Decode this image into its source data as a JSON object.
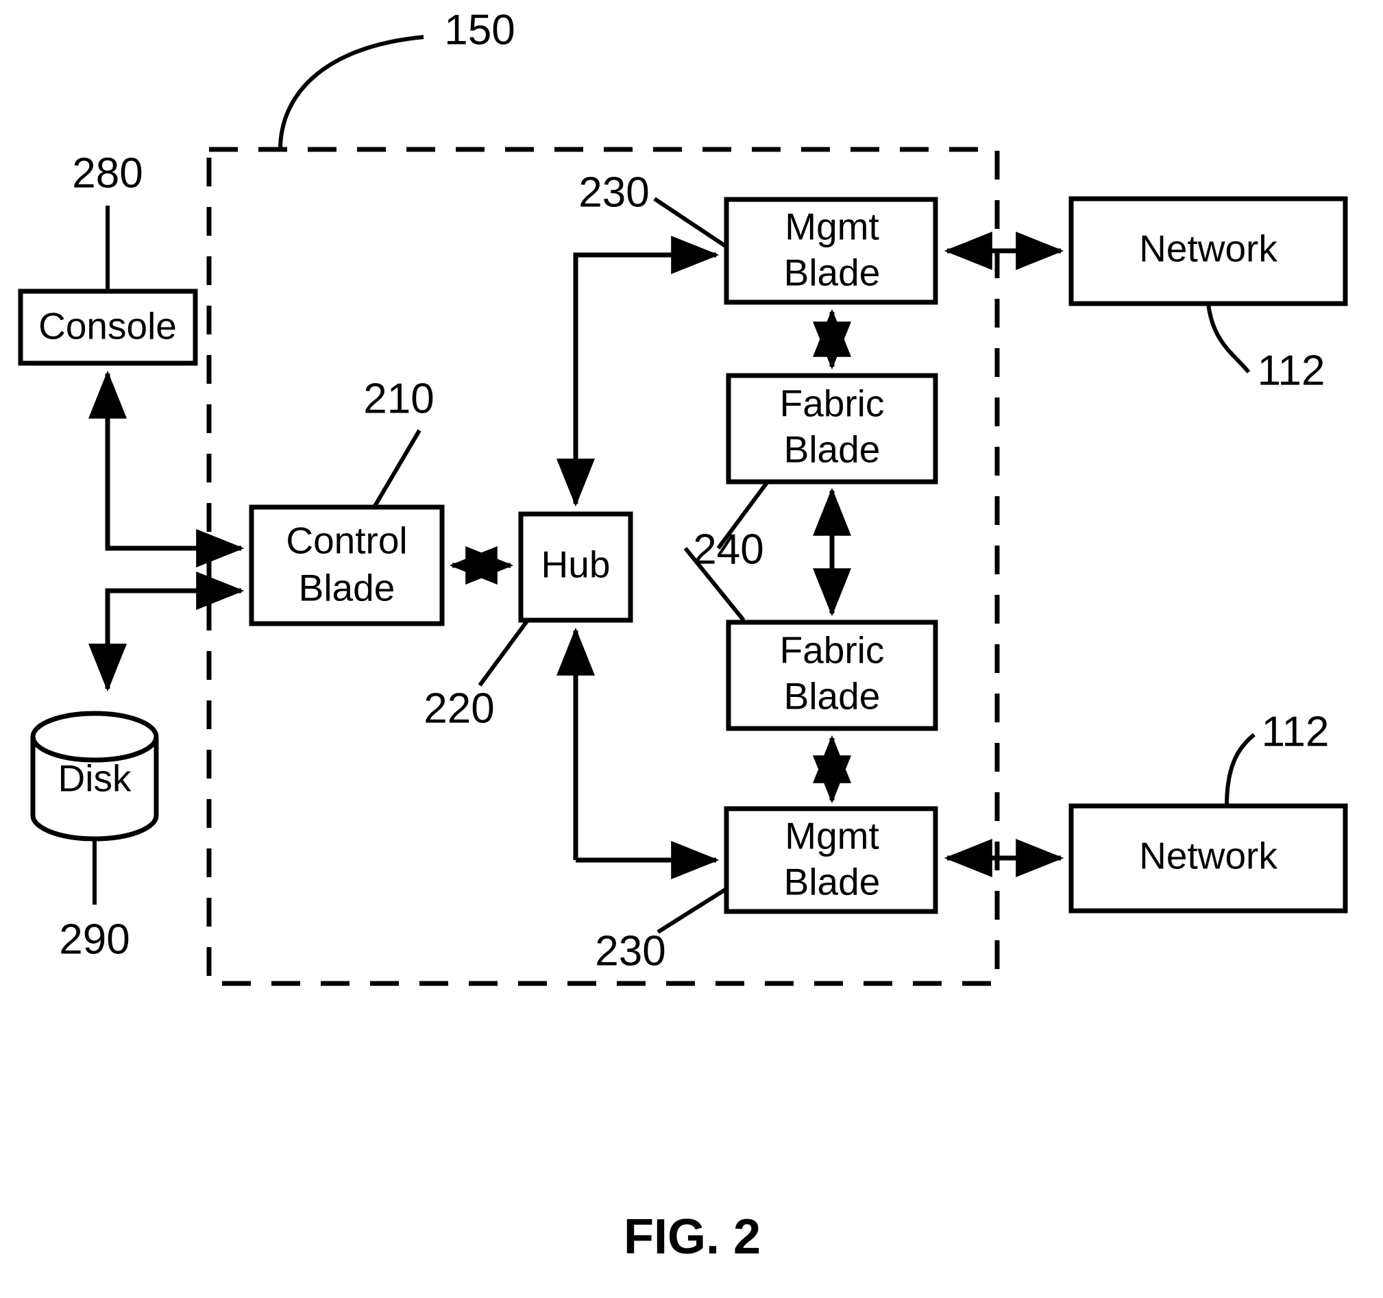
{
  "figure": {
    "caption": "FIG. 2",
    "enclosure_ref": "150"
  },
  "nodes": {
    "console": {
      "label": "Console",
      "ref": "280"
    },
    "disk": {
      "label": "Disk",
      "ref": "290"
    },
    "control_blade": {
      "label_line1": "Control",
      "label_line2": "Blade",
      "ref": "210"
    },
    "hub": {
      "label": "Hub",
      "ref": "220"
    },
    "mgmt_blade_top": {
      "label_line1": "Mgmt",
      "label_line2": "Blade",
      "ref": "230"
    },
    "mgmt_blade_bottom": {
      "label_line1": "Mgmt",
      "label_line2": "Blade",
      "ref": "230"
    },
    "fabric_blade_top": {
      "label_line1": "Fabric",
      "label_line2": "Blade",
      "ref": "240"
    },
    "fabric_blade_bottom": {
      "label_line1": "Fabric",
      "label_line2": "Blade"
    },
    "network_top": {
      "label": "Network",
      "ref": "112"
    },
    "network_bottom": {
      "label": "Network",
      "ref": "112"
    }
  },
  "colors": {
    "line": "#000000",
    "fill": "#ffffff"
  }
}
